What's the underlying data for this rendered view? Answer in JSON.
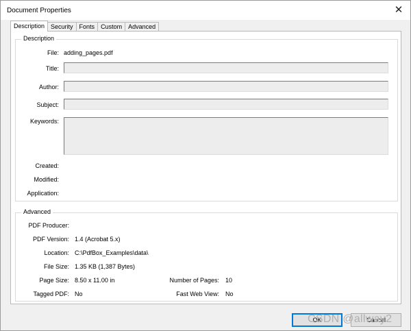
{
  "window": {
    "title": "Document Properties"
  },
  "tabs": [
    "Description",
    "Security",
    "Fonts",
    "Custom",
    "Advanced"
  ],
  "description": {
    "group_title": "Description",
    "file_label": "File:",
    "file_value": "adding_pages.pdf",
    "title_label": "Title:",
    "title_value": "",
    "author_label": "Author:",
    "author_value": "",
    "subject_label": "Subject:",
    "subject_value": "",
    "keywords_label": "Keywords:",
    "keywords_value": "",
    "created_label": "Created:",
    "modified_label": "Modified:",
    "application_label": "Application:"
  },
  "advanced": {
    "group_title": "Advanced",
    "producer_label": "PDF Producer:",
    "version_label": "PDF Version:",
    "version_value": "1.4 (Acrobat 5.x)",
    "location_label": "Location:",
    "location_value": "C:\\PdfBox_Examples\\data\\",
    "filesize_label": "File Size:",
    "filesize_value": "1.35 KB (1,387 Bytes)",
    "pagesize_label": "Page Size:",
    "pagesize_value": "8.50 x 11.00 in",
    "pages_label": "Number of Pages:",
    "pages_value": "10",
    "tagged_label": "Tagged PDF:",
    "tagged_value": "No",
    "fastweb_label": "Fast Web View:",
    "fastweb_value": "No"
  },
  "buttons": {
    "ok": "OK",
    "cancel": "Cancel"
  },
  "watermark": "CSDN @allway2"
}
